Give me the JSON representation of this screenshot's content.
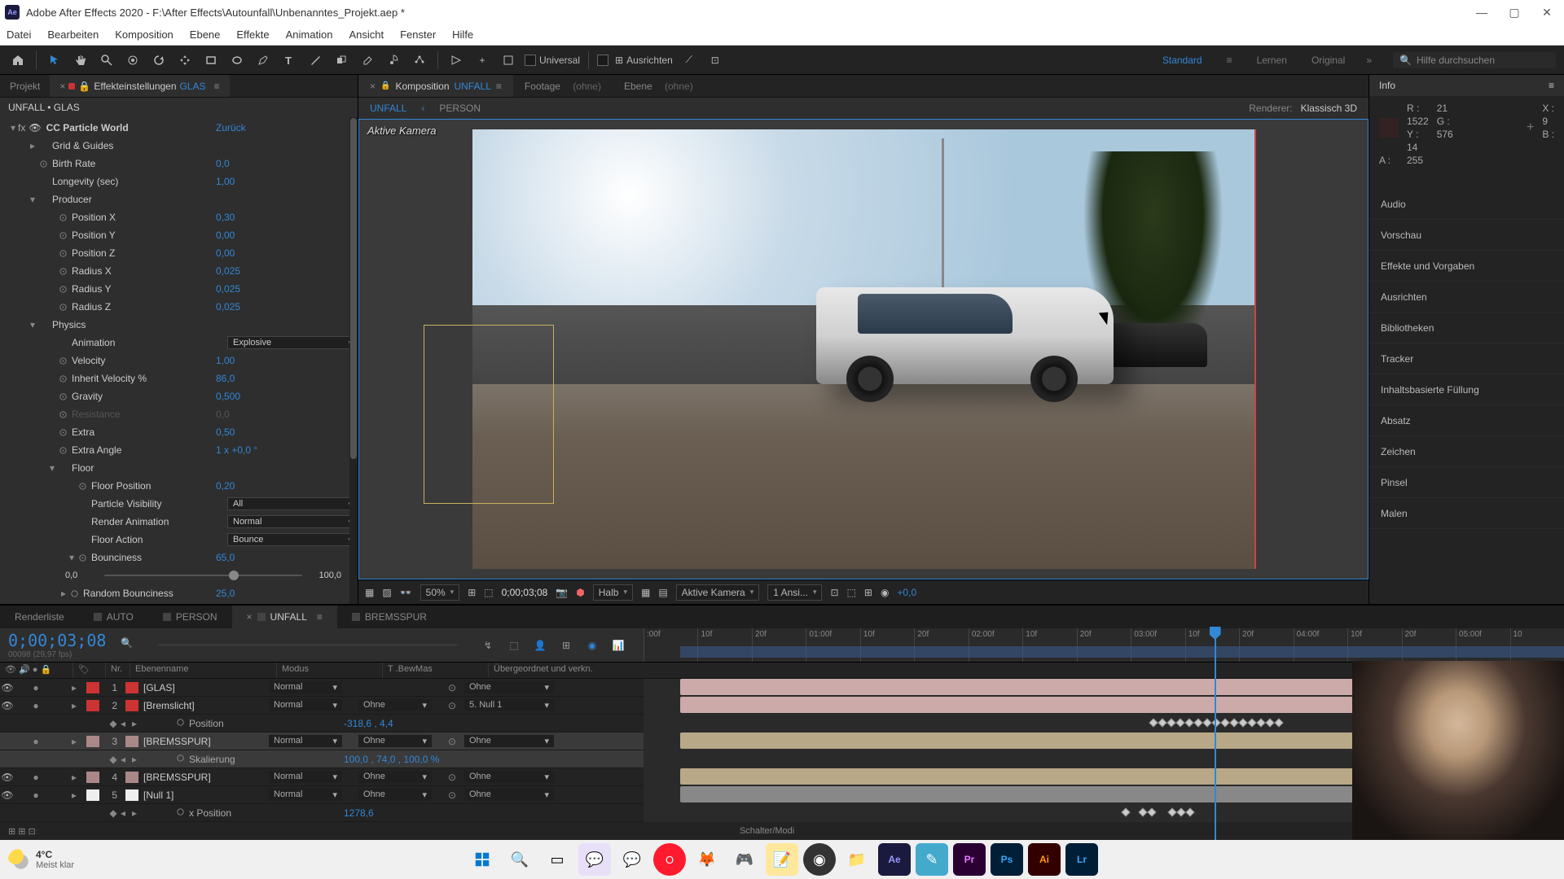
{
  "window": {
    "title": "Adobe After Effects 2020 - F:\\After Effects\\Autounfall\\Unbenanntes_Projekt.aep *"
  },
  "menu": [
    "Datei",
    "Bearbeiten",
    "Komposition",
    "Ebene",
    "Effekte",
    "Animation",
    "Ansicht",
    "Fenster",
    "Hilfe"
  ],
  "toolbar": {
    "snap": "Universal",
    "align": "Ausrichten",
    "search_ph": "Hilfe durchsuchen"
  },
  "workspaces": [
    "Standard",
    "Lernen",
    "Original"
  ],
  "left": {
    "tab_project": "Projekt",
    "tab_effect": "Effekteinstellungen",
    "tab_effect_layer": "GLAS",
    "breadcrumb": "UNFALL • GLAS",
    "fx": {
      "name": "CC Particle World",
      "reset": "Zurück",
      "props": [
        {
          "n": "Grid & Guides",
          "v": "",
          "ind": 1,
          "tw": "▸"
        },
        {
          "n": "Birth Rate",
          "v": "0,0",
          "ind": 1,
          "sw": 1
        },
        {
          "n": "Longevity (sec)",
          "v": "1,00",
          "ind": 1
        },
        {
          "n": "Producer",
          "v": "",
          "ind": 1,
          "tw": "▾"
        },
        {
          "n": "Position X",
          "v": "0,30",
          "ind": 2,
          "sw": 1
        },
        {
          "n": "Position Y",
          "v": "0,00",
          "ind": 2,
          "sw": 1
        },
        {
          "n": "Position Z",
          "v": "0,00",
          "ind": 2,
          "sw": 1
        },
        {
          "n": "Radius X",
          "v": "0,025",
          "ind": 2,
          "sw": 1
        },
        {
          "n": "Radius Y",
          "v": "0,025",
          "ind": 2,
          "sw": 1
        },
        {
          "n": "Radius Z",
          "v": "0,025",
          "ind": 2,
          "sw": 1
        },
        {
          "n": "Physics",
          "v": "",
          "ind": 1,
          "tw": "▾"
        },
        {
          "n": "Animation",
          "v": "",
          "ind": 2,
          "dd": "Explosive"
        },
        {
          "n": "Velocity",
          "v": "1,00",
          "ind": 2,
          "sw": 1
        },
        {
          "n": "Inherit Velocity %",
          "v": "86,0",
          "ind": 2,
          "sw": 1
        },
        {
          "n": "Gravity",
          "v": "0,500",
          "ind": 2,
          "sw": 1
        },
        {
          "n": "Resistance",
          "v": "0,0",
          "ind": 2,
          "sw": 1,
          "dim": 1
        },
        {
          "n": "Extra",
          "v": "0,50",
          "ind": 2,
          "sw": 1
        },
        {
          "n": "Extra Angle",
          "v": "1 x +0,0 °",
          "ind": 2,
          "sw": 1
        },
        {
          "n": "Floor",
          "v": "",
          "ind": 2,
          "tw": "▾"
        },
        {
          "n": "Floor Position",
          "v": "0,20",
          "ind": 3,
          "sw": 1
        },
        {
          "n": "Particle Visibility",
          "v": "",
          "ind": 3,
          "dd": "All"
        },
        {
          "n": "Render Animation",
          "v": "",
          "ind": 3,
          "dd": "Normal"
        },
        {
          "n": "Floor Action",
          "v": "",
          "ind": 3,
          "dd": "Bounce"
        },
        {
          "n": "Bounciness",
          "v": "65,0",
          "ind": 3,
          "sw": 1,
          "tw": "▾"
        }
      ],
      "slider": {
        "min": "0,0",
        "max": "100,0",
        "pos": 65
      },
      "last": {
        "n": "Random Bounciness",
        "v": "25,0"
      }
    }
  },
  "comp": {
    "tab_label": "Komposition",
    "tab_name": "UNFALL",
    "footage": "Footage",
    "footage_none": "(ohne)",
    "layer": "Ebene",
    "layer_none": "(ohne)",
    "crumb_active": "UNFALL",
    "crumb_back": "‹",
    "crumb_next": "PERSON",
    "renderer_label": "Renderer:",
    "renderer": "Klassisch 3D",
    "viewer_label": "Aktive Kamera",
    "bar": {
      "zoom": "50%",
      "tc": "0;00;03;08",
      "res": "Halb",
      "cam": "Aktive Kamera",
      "views": "1 Ansi...",
      "exp": "+0,0"
    }
  },
  "info": {
    "title": "Info",
    "R": "21",
    "G": "9",
    "B": "14",
    "A": "255",
    "X": "1522",
    "Y": "576"
  },
  "right_panels": [
    "Audio",
    "Vorschau",
    "Effekte und Vorgaben",
    "Ausrichten",
    "Bibliotheken",
    "Tracker",
    "Inhaltsbasierte Füllung",
    "Absatz",
    "Zeichen",
    "Pinsel",
    "Malen"
  ],
  "timeline": {
    "tabs": [
      {
        "n": "Renderliste"
      },
      {
        "n": "AUTO",
        "sq": 1
      },
      {
        "n": "PERSON",
        "sq": 1
      },
      {
        "n": "UNFALL",
        "sq": 1,
        "active": 1
      },
      {
        "n": "BREMSSPUR",
        "sq": 1
      }
    ],
    "timecode": "0;00;03;08",
    "timecode_sub": "00098 (29,97 fps)",
    "ruler": [
      ":00f",
      "10f",
      "20f",
      "01:00f",
      "10f",
      "20f",
      "02:00f",
      "10f",
      "20f",
      "03:00f",
      "10f",
      "20f",
      "04:00f",
      "10f",
      "20f",
      "05:00f",
      "10"
    ],
    "cols": {
      "nr": "Nr.",
      "name": "Ebenenname",
      "mode": "Modus",
      "trk": "T  .BewMas",
      "parent": "Übergeordnet und verkn."
    },
    "layers": [
      {
        "eye": 1,
        "n": "1",
        "c": "#c33",
        "name": "[GLAS]",
        "mode": "Normal",
        "trk": "",
        "par": "Ohne"
      },
      {
        "eye": 1,
        "n": "2",
        "c": "#c33",
        "name": "[Bremslicht]",
        "mode": "Normal",
        "trk": "Ohne",
        "par": "5. Null 1"
      },
      {
        "prop": 1,
        "name": "Position",
        "val": "-318,6 , 4,4"
      },
      {
        "eye": 0,
        "n": "3",
        "c": "#a88",
        "name": "[BREMSSPUR]",
        "mode": "Normal",
        "trk": "Ohne",
        "par": "Ohne",
        "sel": 1
      },
      {
        "prop": 1,
        "name": "Skalierung",
        "val": "100,0 , 74,0 , 100,0 %",
        "sel": 1
      },
      {
        "eye": 1,
        "n": "4",
        "c": "#a88",
        "name": "[BREMSSPUR]",
        "mode": "Normal",
        "trk": "Ohne",
        "par": "Ohne"
      },
      {
        "eye": 1,
        "n": "5",
        "c": "#eee",
        "name": "[Null 1]",
        "mode": "Normal",
        "trk": "Ohne",
        "par": "Ohne"
      },
      {
        "prop": 1,
        "name": "x Position",
        "val": "1278,6"
      }
    ],
    "footer": "Schalter/Modi"
  },
  "taskbar": {
    "temp": "4°C",
    "cond": "Meist klar"
  }
}
